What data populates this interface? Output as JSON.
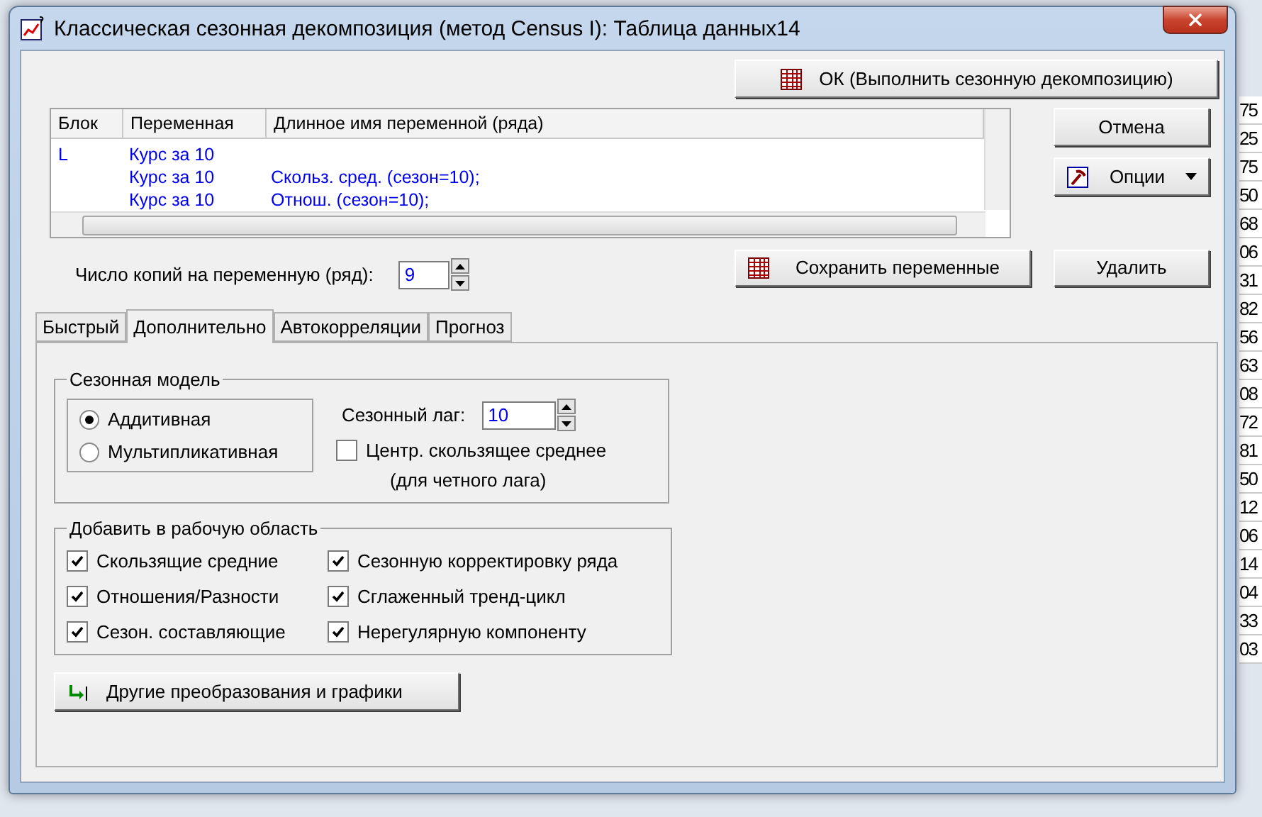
{
  "back_window": {
    "cells": [
      "75",
      "25",
      "75",
      "50",
      "68",
      "06",
      "31",
      "82",
      "56",
      "63",
      "08",
      "72",
      "81",
      "50",
      "12",
      "06",
      "14",
      "04",
      "33",
      "03"
    ]
  },
  "window": {
    "title": "Классическая сезонная декомпозиция (метод Census I): Таблица данных14"
  },
  "ok_button": "ОК (Выполнить сезонную декомпозицию)",
  "variables": {
    "columns": [
      "Блок",
      "Переменная",
      "Длинное имя переменной (ряда)"
    ],
    "rows": [
      {
        "block": "L",
        "variable": "Курс за 10",
        "long_name": ""
      },
      {
        "block": "",
        "variable": "Курс за 10",
        "long_name": "Скольз. сред. (сезон=10);"
      },
      {
        "block": "",
        "variable": "Курс за 10",
        "long_name": "Отнош. (сезон=10);"
      }
    ]
  },
  "cancel_button": "Отмена",
  "options_button": "Опции",
  "copies": {
    "label": "Число копий на переменную (ряд):",
    "value": "9"
  },
  "save_button": "Сохранить переменные",
  "delete_button": "Удалить",
  "tabs": [
    {
      "label": "Быстрый",
      "selected": false
    },
    {
      "label": "Дополнительно",
      "selected": true
    },
    {
      "label": "Автокорреляции",
      "selected": false
    },
    {
      "label": "Прогноз",
      "selected": false
    }
  ],
  "seasonal_model": {
    "title": "Сезонная модель",
    "options": [
      {
        "label": "Аддитивная",
        "selected": true
      },
      {
        "label": "Мультипликативная",
        "selected": false
      }
    ],
    "lag_label": "Сезонный лаг:",
    "lag_value": "10",
    "centered": {
      "label": "Центр. скользящее среднее",
      "note": "(для четного лага)",
      "checked": false
    }
  },
  "workspace": {
    "title": "Добавить в рабочую область",
    "items": [
      {
        "label": "Скользящие средние",
        "checked": true
      },
      {
        "label": "Сезонную корректировку ряда",
        "checked": true
      },
      {
        "label": "Отношения/Разности",
        "checked": true
      },
      {
        "label": "Сглаженный тренд-цикл",
        "checked": true
      },
      {
        "label": "Сезон. составляющие",
        "checked": true
      },
      {
        "label": "Нерегулярную компоненту",
        "checked": true
      }
    ]
  },
  "other_button": "Другие преобразования и графики"
}
